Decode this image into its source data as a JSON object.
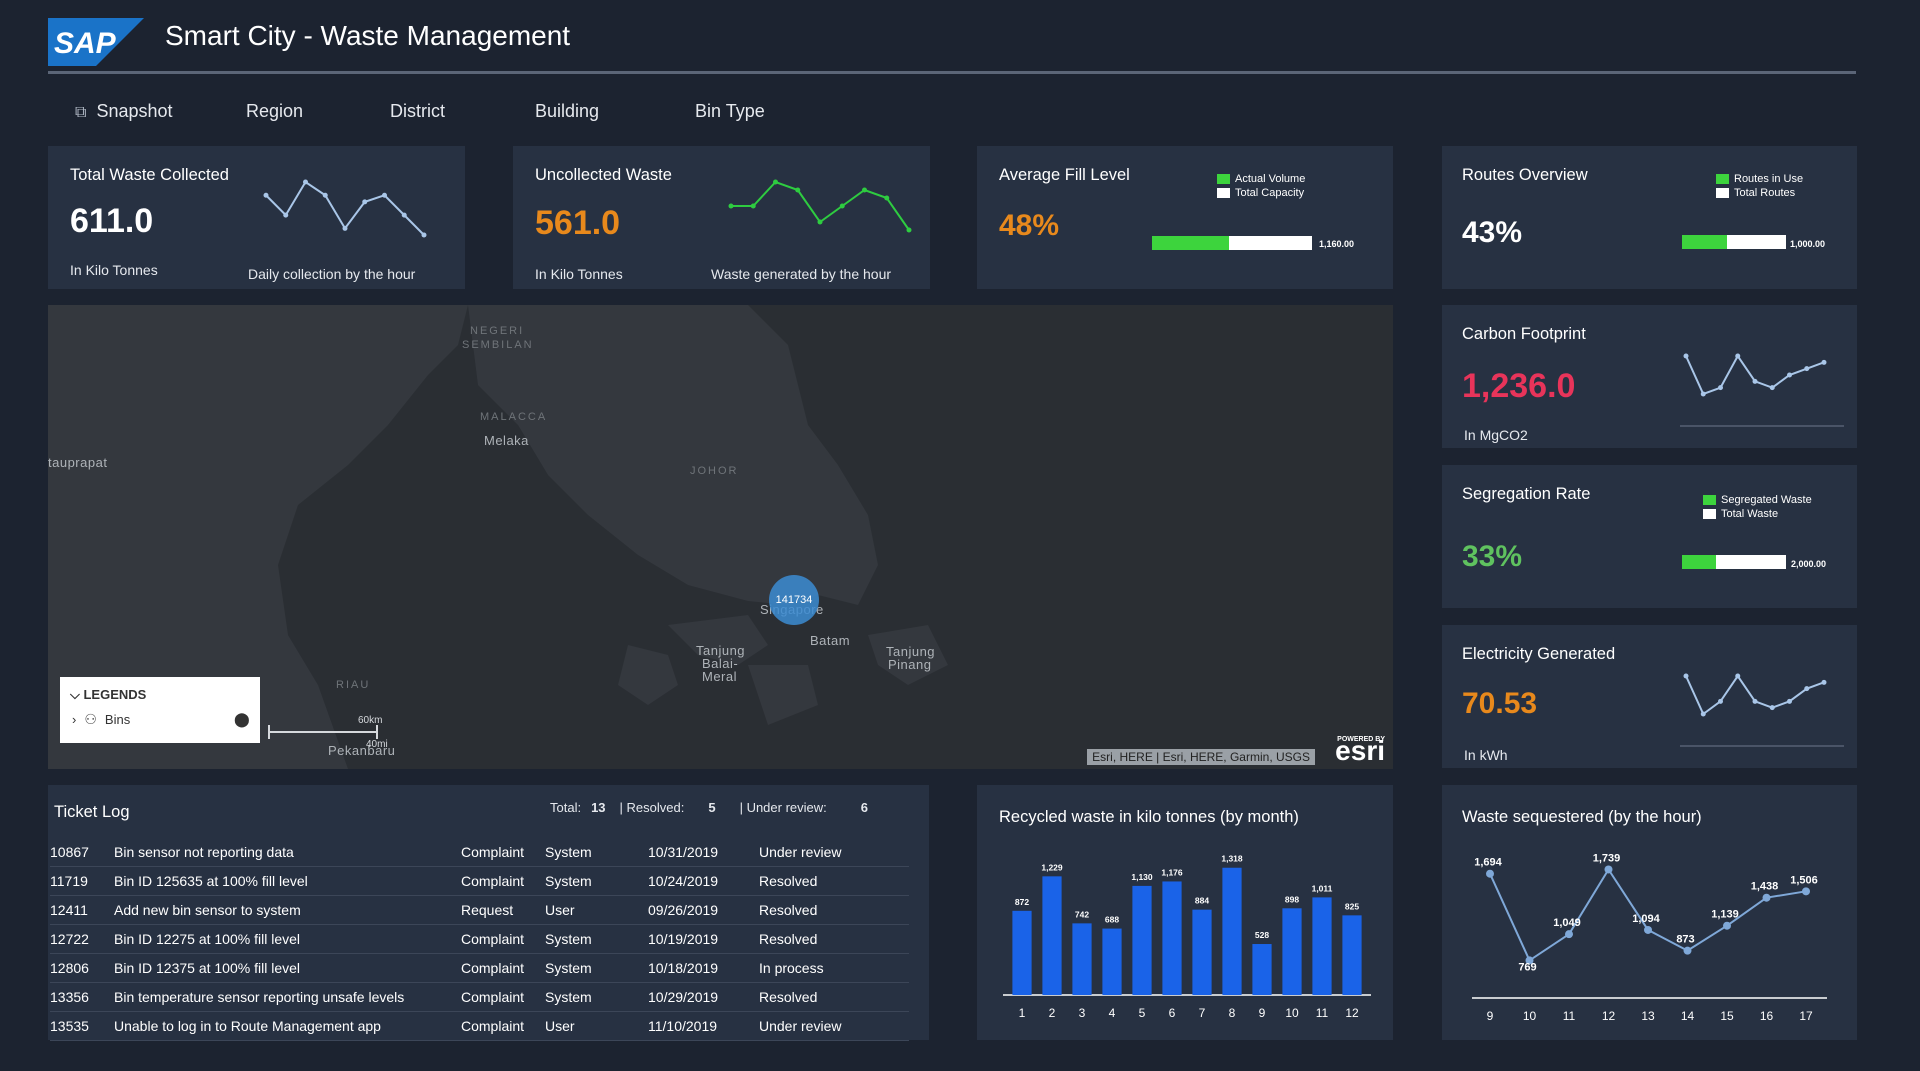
{
  "header": {
    "logo_text": "SAP",
    "title": "Smart City - Waste Management",
    "brand_color": "#1a73c8"
  },
  "nav": {
    "tabs": [
      {
        "label": "Snapshot",
        "icon": "snapshot-icon"
      },
      {
        "label": "Region"
      },
      {
        "label": "District"
      },
      {
        "label": "Building"
      },
      {
        "label": "Bin Type"
      }
    ]
  },
  "total_waste": {
    "title": "Total Waste Collected",
    "value": "611.0",
    "unit": "In Kilo Tonnes",
    "caption": "Daily collection by the hour",
    "spark": [
      6,
      3,
      8,
      6,
      1,
      5,
      6,
      3,
      0
    ],
    "color": "#ffffff"
  },
  "uncollected": {
    "title": "Uncollected Waste",
    "value": "561.0",
    "unit": "In Kilo Tonnes",
    "caption": "Waste generated by the hour",
    "spark": [
      3,
      3,
      6,
      5,
      1,
      3,
      5,
      4,
      0
    ],
    "color": "#e8891c"
  },
  "fill_level": {
    "title": "Average Fill Level",
    "value": "48%",
    "legend_actual": "Actual Volume",
    "legend_total": "Total Capacity",
    "max_label": "1,160.00",
    "fraction": 0.48,
    "color": "#e8891c"
  },
  "routes": {
    "title": "Routes Overview",
    "value": "43%",
    "legend_actual": "Routes in Use",
    "legend_total": "Total Routes",
    "max_label": "1,000.00",
    "fraction": 0.43,
    "color": "#ffffff"
  },
  "carbon": {
    "title": "Carbon Footprint",
    "value": "1,236.0",
    "unit": "In MgCO2",
    "spark": [
      7,
      1,
      2,
      7,
      3,
      2,
      4,
      5,
      6
    ],
    "color": "#e8345a"
  },
  "segregation": {
    "title": "Segregation Rate",
    "value": "33%",
    "legend_actual": "Segregated Waste",
    "legend_total": "Total Waste",
    "max_label": "2,000.00",
    "fraction": 0.33,
    "color": "#5fc25f"
  },
  "electricity": {
    "title": "Electricity Generated",
    "value": "70.53",
    "unit": "In kWh",
    "spark": [
      7,
      1,
      3,
      7,
      3,
      2,
      3,
      5,
      6
    ],
    "color": "#e8891c"
  },
  "map": {
    "labels": [
      {
        "text": "NEGERI",
        "cls": "region"
      },
      {
        "text": "SEMBILAN",
        "cls": "region"
      },
      {
        "text": "MALACCA",
        "cls": "region"
      },
      {
        "text": "Melaka",
        "cls": ""
      },
      {
        "text": "tauprapat",
        "cls": ""
      },
      {
        "text": "JOHOR",
        "cls": "region"
      },
      {
        "text": "Batam",
        "cls": ""
      },
      {
        "text": "Tanjung",
        "cls": ""
      },
      {
        "text": "Balai-",
        "cls": ""
      },
      {
        "text": "Meral",
        "cls": ""
      },
      {
        "text": "Tanjung",
        "cls": ""
      },
      {
        "text": "Pinang",
        "cls": ""
      },
      {
        "text": "RIAU",
        "cls": "region"
      },
      {
        "text": "Pekanbaru",
        "cls": ""
      },
      {
        "text": "Singapore",
        "cls": ""
      }
    ],
    "cluster_count": "141734",
    "legend_title": "LEGENDS",
    "legend_item": "Bins",
    "scale_km": "60km",
    "scale_mi": "40mi",
    "attribution": "Esri, HERE | Esri, HERE, Garmin, USGS",
    "powered_by": "POWERED BY",
    "esri": "esri"
  },
  "ticket_log": {
    "title": "Ticket Log",
    "total_label": "Total:",
    "total": "13",
    "resolved_label": "| Resolved:",
    "resolved": "5",
    "review_label": "| Under review:",
    "review": "6",
    "rows": [
      [
        "10867",
        "Bin sensor not reporting data",
        "Complaint",
        "System",
        "10/31/2019",
        "Under review"
      ],
      [
        "11719",
        "Bin ID 125635 at 100% fill level",
        "Complaint",
        "System",
        "10/24/2019",
        "Resolved"
      ],
      [
        "12411",
        "Add new bin sensor to system",
        "Request",
        "User",
        "09/26/2019",
        "Resolved"
      ],
      [
        "12722",
        "Bin ID 12275 at 100% fill level",
        "Complaint",
        "System",
        "10/19/2019",
        "Resolved"
      ],
      [
        "12806",
        "Bin ID 12375 at 100% fill level",
        "Complaint",
        "System",
        "10/18/2019",
        "In process"
      ],
      [
        "13356",
        "Bin temperature sensor reporting unsafe levels",
        "Complaint",
        "System",
        "10/29/2019",
        "Resolved"
      ],
      [
        "13535",
        "Unable to log in to Route Management app",
        "Complaint",
        "User",
        "11/10/2019",
        "Under review"
      ]
    ]
  },
  "chart_data": [
    {
      "type": "bar",
      "title": "Recycled waste in kilo tonnes (by month)",
      "categories": [
        "1",
        "2",
        "3",
        "4",
        "5",
        "6",
        "7",
        "8",
        "9",
        "10",
        "11",
        "12"
      ],
      "values": [
        872,
        1229,
        742,
        688,
        1130,
        1176,
        884,
        1318,
        528,
        898,
        1011,
        825
      ],
      "value_labels": [
        "872",
        "1,229",
        "742",
        "688",
        "1,130",
        "1,176",
        "884",
        "1,318",
        "528",
        "898",
        "1,011",
        "825"
      ],
      "ylim": [
        0,
        1450
      ],
      "color": "#1a63e8"
    },
    {
      "type": "line",
      "title": "Waste sequestered (by the hour)",
      "categories": [
        "9",
        "10",
        "11",
        "12",
        "13",
        "14",
        "15",
        "16",
        "17"
      ],
      "values": [
        1694,
        769,
        1049,
        1739,
        1094,
        873,
        1139,
        1438,
        1506
      ],
      "value_labels": [
        "1,694",
        "769",
        "1,049",
        "1,739",
        "1,094",
        "873",
        "1,139",
        "1,438",
        "1,506"
      ],
      "ylim": [
        400,
        2000
      ],
      "color": "#7fa8d8"
    }
  ]
}
